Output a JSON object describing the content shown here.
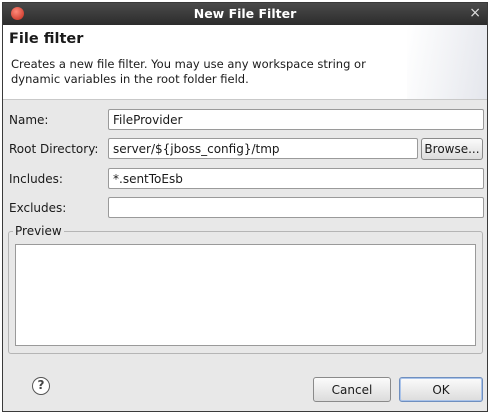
{
  "window": {
    "title": "New File Filter",
    "close_glyph": "×"
  },
  "header": {
    "title": "File filter",
    "description": "Creates a new file filter. You may use any workspace string or dynamic variables in the root folder field."
  },
  "fields": {
    "name": {
      "label": "Name:",
      "value": "FileProvider"
    },
    "root_directory": {
      "label": "Root Directory:",
      "value": "server/${jboss_config}/tmp",
      "browse_label": "Browse..."
    },
    "includes": {
      "label": "Includes:",
      "value": "*.sentToEsb"
    },
    "excludes": {
      "label": "Excludes:",
      "value": ""
    }
  },
  "preview": {
    "label": "Preview"
  },
  "footer": {
    "help_glyph": "?",
    "cancel_label": "Cancel",
    "ok_label": "OK"
  },
  "icons": {
    "app": "app-logo-icon",
    "help": "help-icon",
    "close": "close-icon"
  }
}
